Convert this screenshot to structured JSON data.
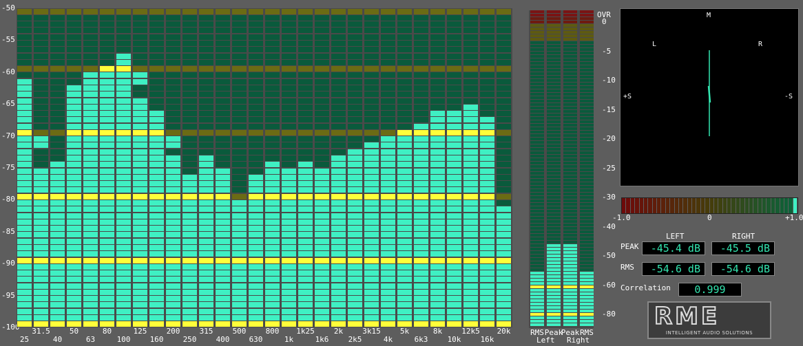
{
  "spectrum": {
    "db_ticks": [
      "-50",
      "-55",
      "-60",
      "-65",
      "-70",
      "-75",
      "-80",
      "-85",
      "-90",
      "-95",
      "-100"
    ],
    "bands": [
      {
        "top": "",
        "bottom": "25",
        "db": -61.5
      },
      {
        "top": "31.5",
        "bottom": "",
        "db": -75.5
      },
      {
        "top": "",
        "bottom": "40",
        "db": -76.5
      },
      {
        "top": "50",
        "bottom": "",
        "db": -64.5
      },
      {
        "top": "",
        "bottom": "63",
        "db": -60.5
      },
      {
        "top": "80",
        "bottom": "",
        "db": -59.5
      },
      {
        "top": "",
        "bottom": "100",
        "db": -57.5
      },
      {
        "top": "125",
        "bottom": "",
        "db": -64.5
      },
      {
        "top": "",
        "bottom": "160",
        "db": -66.5
      },
      {
        "top": "200",
        "bottom": "",
        "db": -73.5
      },
      {
        "top": "",
        "bottom": "250",
        "db": -76.5
      },
      {
        "top": "315",
        "bottom": "",
        "db": -73.5
      },
      {
        "top": "",
        "bottom": "400",
        "db": -77.5
      },
      {
        "top": "500",
        "bottom": "",
        "db": -80.5
      },
      {
        "top": "",
        "bottom": "630",
        "db": -76.5
      },
      {
        "top": "800",
        "bottom": "",
        "db": -74.5
      },
      {
        "top": "",
        "bottom": "1k",
        "db": -75.5
      },
      {
        "top": "1k25",
        "bottom": "",
        "db": -75.5
      },
      {
        "top": "",
        "bottom": "1k6",
        "db": -76.5
      },
      {
        "top": "2k",
        "bottom": "",
        "db": -73.5
      },
      {
        "top": "",
        "bottom": "2k5",
        "db": -72.5
      },
      {
        "top": "3k15",
        "bottom": "",
        "db": -71.5
      },
      {
        "top": "",
        "bottom": "4k",
        "db": -70.5
      },
      {
        "top": "5k",
        "bottom": "",
        "db": -69.5
      },
      {
        "top": "",
        "bottom": "6k3",
        "db": -68.5
      },
      {
        "top": "8k",
        "bottom": "",
        "db": -66.5
      },
      {
        "top": "",
        "bottom": "10k",
        "db": -66.5
      },
      {
        "top": "12k5",
        "bottom": "",
        "db": -65.5
      },
      {
        "top": "",
        "bottom": "16k",
        "db": -67.5
      },
      {
        "top": "20k",
        "bottom": "",
        "db": -83.5
      }
    ],
    "peak_holds": [
      -61.5,
      -71,
      -75,
      -63,
      -60,
      -60,
      -60,
      -61,
      -66.5,
      -71,
      -76.5,
      -73.5,
      -76,
      -80,
      -76.5,
      -74.5,
      -75.5,
      -75,
      -76,
      -73.5,
      -72.5,
      -71.5,
      -70.5,
      -69.5,
      -68.5,
      -66.5,
      -66.5,
      -65.5,
      -67.5,
      -82
    ],
    "colors": {
      "bar": "#3ff0c3",
      "dark": "#0a5a3c",
      "hold": "#ffff3a",
      "marker": "#6b6b14"
    }
  },
  "level_meter": {
    "over_label": "OVR",
    "db_ticks": [
      "0",
      "-5",
      "-10",
      "-15",
      "-20",
      "-25",
      "-30",
      "-40",
      "-50",
      "-60",
      "-80"
    ],
    "columns": [
      {
        "label": "RMS",
        "sub": "Left",
        "level": -54.6
      },
      {
        "label": "Peak",
        "sub": "",
        "level": -45.4
      },
      {
        "label": "Peak",
        "sub": "",
        "level": -45.5
      },
      {
        "label": "RMS",
        "sub": "Right",
        "level": -54.6
      }
    ],
    "bottom_left": "Left",
    "bottom_right": "Right"
  },
  "goniometer": {
    "labels": {
      "m": "M",
      "l": "L",
      "r": "R",
      "plus_s": "+S",
      "minus_s": "-S"
    },
    "trace_color": "#33e6b0"
  },
  "correlation": {
    "scale": [
      "-1.0",
      "0",
      "+1.0"
    ],
    "value": 0.999,
    "label": "Correlation",
    "readout": "0.999"
  },
  "readouts": {
    "left_header": "LEFT",
    "right_header": "RIGHT",
    "peak_label": "PEAK",
    "rms_label": "RMS",
    "peak_left": "-45.4 dB",
    "peak_right": "-45.5 dB",
    "rms_left": "-54.6 dB",
    "rms_right": "-54.6 dB"
  },
  "logo": {
    "mark": "RME",
    "tagline": "INTELLIGENT AUDIO SOLUTIONS"
  }
}
